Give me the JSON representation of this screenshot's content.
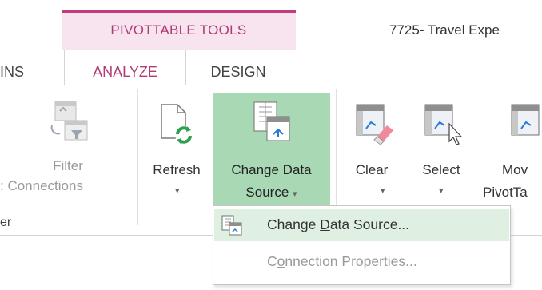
{
  "contextual_group": {
    "title": "PIVOTTABLE TOOLS"
  },
  "window": {
    "title": "7725-  Travel Expe"
  },
  "tabs": {
    "partial": "INS",
    "analyze": "ANALYZE",
    "design": "DESIGN"
  },
  "ribbon": {
    "filter": {
      "line1": "Filter",
      "line2": ": Connections"
    },
    "refresh": {
      "label": "Refresh",
      "caret": "▾"
    },
    "change_data_source": {
      "line1": "Change Data",
      "line2": "Source",
      "caret": "▾"
    },
    "clear": {
      "label": "Clear",
      "caret": "▾"
    },
    "select": {
      "label": "Select",
      "caret": "▾"
    },
    "move": {
      "line1": "Mov",
      "line2": "PivotTa"
    },
    "group_label": "er"
  },
  "menu": {
    "items": [
      {
        "pre": "Change ",
        "accel": "D",
        "post": "ata Source...",
        "enabled": true
      },
      {
        "pre": "C",
        "accel": "o",
        "post": "nnection Properties...",
        "enabled": false
      }
    ]
  },
  "colors": {
    "accent": "#b03a76",
    "contextual_band": "#f8e4ef",
    "button_highlight": "#a8d8b4",
    "menu_highlight": "#dff0e3"
  }
}
